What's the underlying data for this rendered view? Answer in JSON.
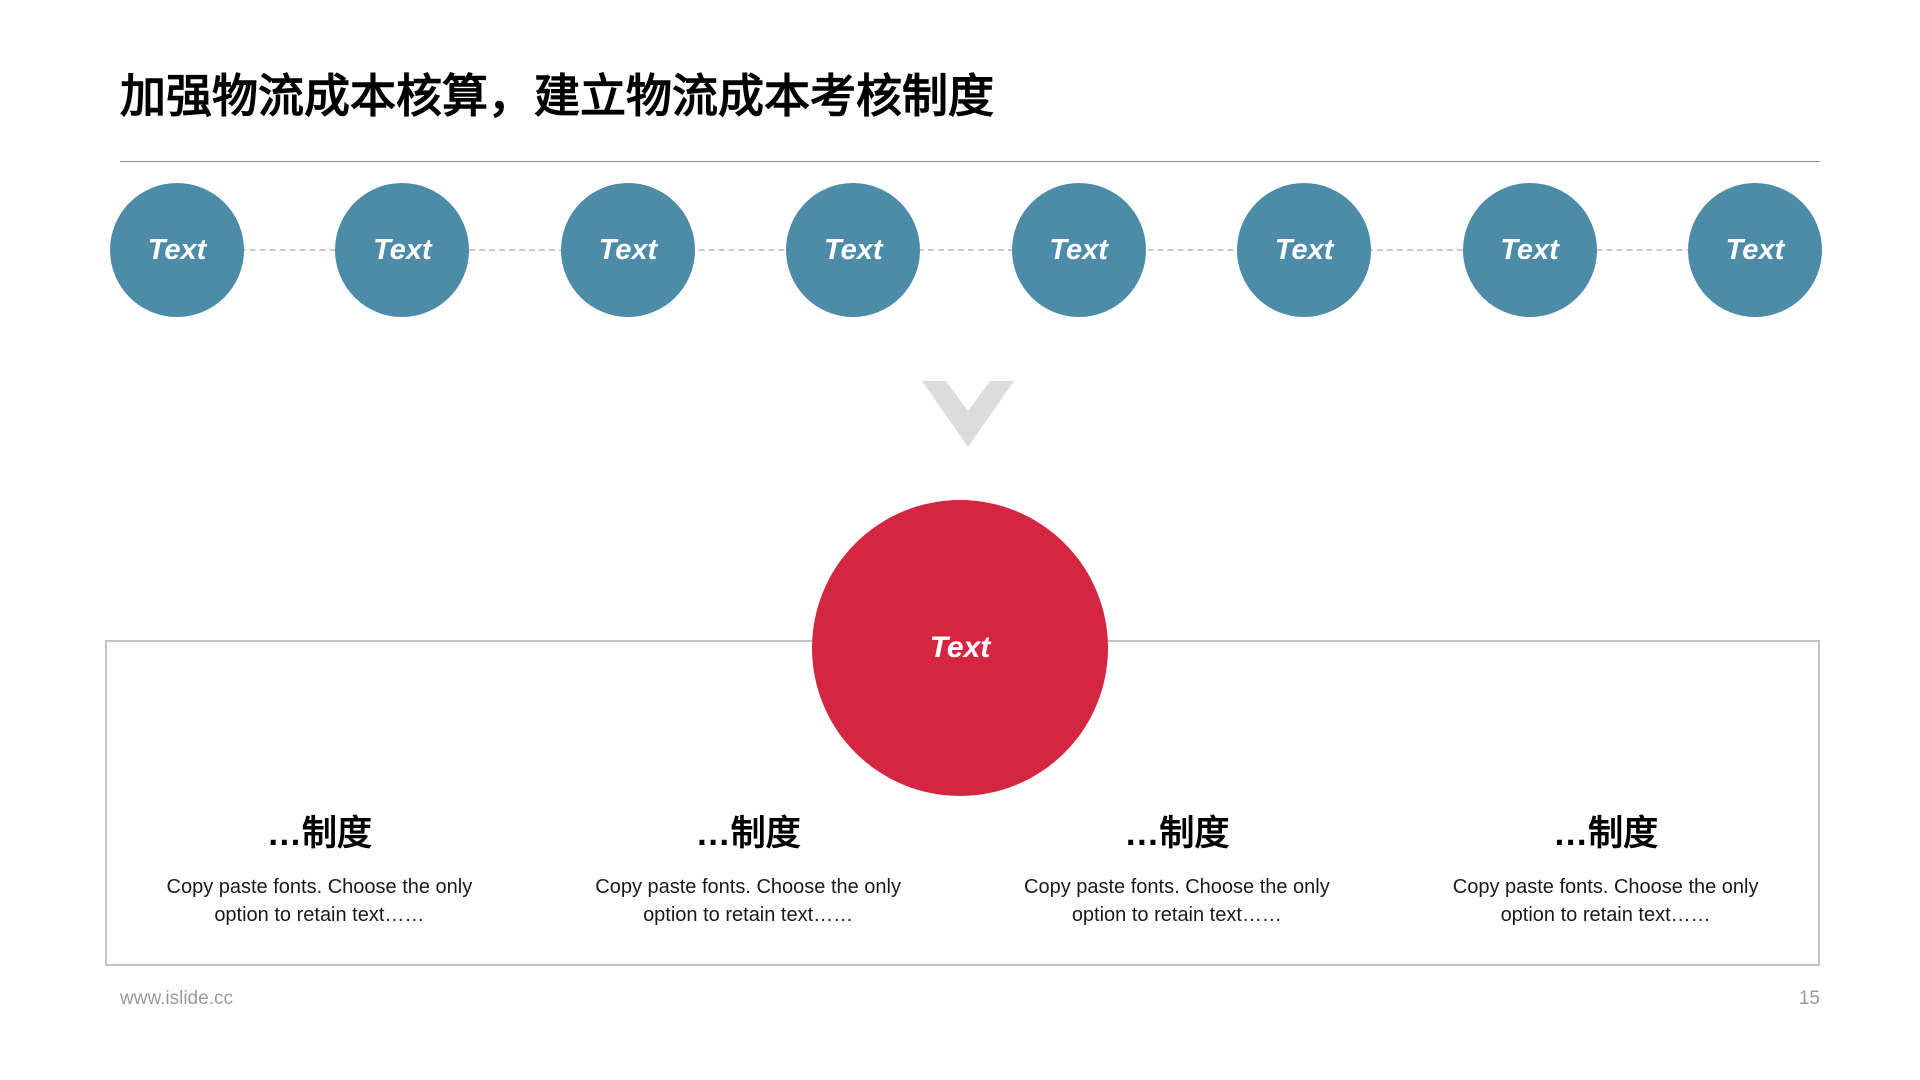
{
  "slide": {
    "title": "加强物流成本核算，建立物流成本考核制度",
    "page_number": "15",
    "footer_url": "www.islide.cc",
    "colors": {
      "node_blue": "#4D8CA8",
      "hub_red": "#D52641",
      "chevron_gray": "#DCDCDC",
      "rule_gray": "#8F8F8F",
      "box_border_gray": "#C2C2C2",
      "footer_gray": "#9A9A9A"
    }
  },
  "chain": {
    "nodes": [
      {
        "label": "Text"
      },
      {
        "label": "Text"
      },
      {
        "label": "Text"
      },
      {
        "label": "Text"
      },
      {
        "label": "Text"
      },
      {
        "label": "Text"
      },
      {
        "label": "Text"
      },
      {
        "label": "Text"
      }
    ]
  },
  "hub": {
    "label": "Text"
  },
  "columns": [
    {
      "heading": "…制度",
      "body": "Copy paste fonts. Choose the only option to retain text……"
    },
    {
      "heading": "…制度",
      "body": "Copy paste fonts. Choose the only option to retain text……"
    },
    {
      "heading": "…制度",
      "body": "Copy paste fonts. Choose the only option to retain text……"
    },
    {
      "heading": "…制度",
      "body": "Copy paste fonts. Choose the only option to retain text……"
    }
  ]
}
